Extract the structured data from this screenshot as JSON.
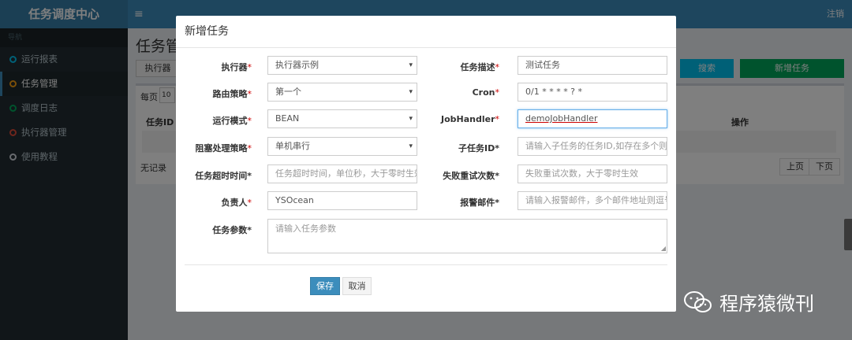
{
  "app": {
    "logo": "任务调度中心",
    "menu_icon": "hamburger-icon",
    "logout": "注销"
  },
  "sidebar": {
    "header": "导航",
    "items": [
      {
        "label": "运行报表",
        "color": "#00c0ef"
      },
      {
        "label": "任务管理",
        "color": "#f39c12"
      },
      {
        "label": "调度日志",
        "color": "#00a65a"
      },
      {
        "label": "执行器管理",
        "color": "#dd4b39"
      },
      {
        "label": "使用教程",
        "color": "#d2d6de"
      }
    ]
  },
  "main": {
    "title": "任务管",
    "executor_filter": "执行器",
    "search": "搜索",
    "add_task": "新增任务",
    "per_page": "每页",
    "per_page_value": "10",
    "col_id": "任务ID",
    "col_ops": "操作",
    "no_records": "无记录",
    "prev": "上页",
    "next": "下页"
  },
  "modal": {
    "title": "新增任务",
    "executor": {
      "label": "执行器",
      "value": "执行器示例"
    },
    "desc": {
      "label": "任务描述",
      "value": "测试任务"
    },
    "route": {
      "label": "路由策略",
      "value": "第一个"
    },
    "cron": {
      "label": "Cron",
      "value": "0/1 * * * * ? *"
    },
    "mode": {
      "label": "运行模式",
      "value": "BEAN"
    },
    "jobhandler": {
      "label": "JobHandler",
      "value": "demoJobHandler"
    },
    "block": {
      "label": "阻塞处理策略",
      "value": "单机串行"
    },
    "child": {
      "label": "子任务ID*",
      "placeholder": "请输入子任务的任务ID,如存在多个则逗号分隔"
    },
    "timeout": {
      "label": "任务超时时间*",
      "placeholder": "任务超时时间，单位秒，大于零时生效"
    },
    "retry": {
      "label": "失败重试次数*",
      "placeholder": "失败重试次数，大于零时生效"
    },
    "owner": {
      "label": "负责人",
      "value": "YSOcean"
    },
    "alarm": {
      "label": "报警邮件*",
      "placeholder": "请输入报警邮件，多个邮件地址则逗号分隔"
    },
    "params": {
      "label": "任务参数*",
      "placeholder": "请输入任务参数"
    },
    "save": "保存",
    "cancel": "取消"
  },
  "watermark": {
    "text": "程序猿微刊"
  },
  "colors": {
    "primary": "#3c8dbc",
    "success": "#00a65a",
    "info": "#00c0ef",
    "required": "#cc0000"
  }
}
